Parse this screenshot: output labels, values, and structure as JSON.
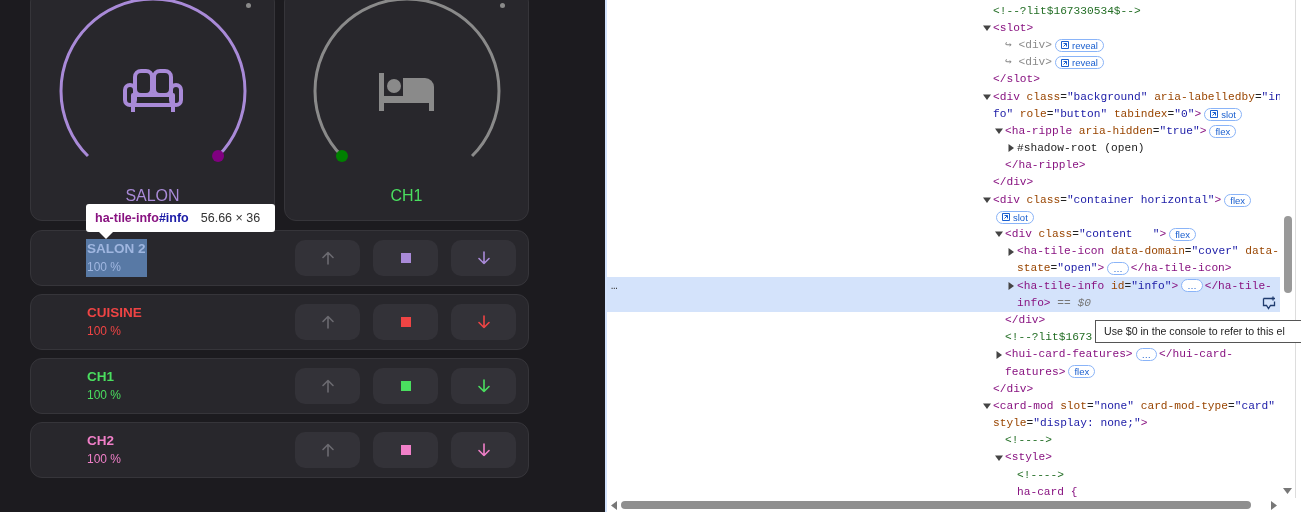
{
  "dials": [
    {
      "name": "SALON",
      "color": "#a98ad8",
      "active": true
    },
    {
      "name": "CH1",
      "color": "#4ade5f",
      "active": false
    }
  ],
  "inspect_tooltip": {
    "selector_tag": "ha-tile-info",
    "selector_id": "#info",
    "size": "56.66 × 36"
  },
  "rows": [
    {
      "name": "SALON 2",
      "reading": "100 %",
      "color": "#a98ad8",
      "highlighted": true,
      "up_disabled": true
    },
    {
      "name": "CUISINE",
      "reading": "100 %",
      "color": "#ef4444",
      "highlighted": false,
      "up_disabled": true
    },
    {
      "name": "CH1",
      "reading": "100 %",
      "color": "#4ade5f",
      "highlighted": false,
      "up_disabled": true
    },
    {
      "name": "CH2",
      "reading": "100 %",
      "color": "#f07fc8",
      "highlighted": false,
      "up_disabled": true
    }
  ],
  "devtools": {
    "nodes": [
      {
        "children": [
          {
            "open": [
              [
                {
                  "kind": "comment",
                  "text": "<!--?lit$167330534$-->"
                }
              ]
            ]
          },
          {
            "expanded": true,
            "open": [
              [
                {
                  "kind": "tag",
                  "text": "<slot>"
                }
              ]
            ],
            "children": [
              {
                "open": [
                  [
                    {
                      "kind": "dim",
                      "text": "↪ <div>"
                    },
                    {
                      "kind": "badge",
                      "text": "reveal",
                      "icon": true
                    }
                  ]
                ]
              },
              {
                "open": [
                  [
                    {
                      "kind": "dim",
                      "text": "↪ <div>"
                    },
                    {
                      "kind": "badge",
                      "text": "reveal",
                      "icon": true
                    }
                  ]
                ]
              }
            ],
            "close": [
              {
                "kind": "tag",
                "text": "</slot>"
              }
            ]
          }
        ]
      },
      {
        "expanded": true,
        "open": [
          [
            {
              "kind": "tag",
              "text": "<div "
            },
            {
              "kind": "attr",
              "text": "class"
            },
            {
              "kind": "plain",
              "text": "="
            },
            {
              "kind": "val",
              "text": "\"background\" "
            },
            {
              "kind": "attr",
              "text": "aria-labelledby"
            },
            {
              "kind": "plain",
              "text": "="
            },
            {
              "kind": "val",
              "text": "\"in"
            }
          ],
          [
            {
              "kind": "val",
              "text": "fo\" "
            },
            {
              "kind": "attr",
              "text": "role"
            },
            {
              "kind": "plain",
              "text": "="
            },
            {
              "kind": "val",
              "text": "\"button\" "
            },
            {
              "kind": "attr",
              "text": "tabindex"
            },
            {
              "kind": "plain",
              "text": "="
            },
            {
              "kind": "val",
              "text": "\"0\""
            },
            {
              "kind": "tag",
              "text": ">"
            },
            {
              "kind": "badge",
              "text": "slot",
              "icon": true
            }
          ]
        ],
        "children": [
          {
            "expanded": true,
            "open": [
              [
                {
                  "kind": "tag",
                  "text": "<ha-ripple "
                },
                {
                  "kind": "attr",
                  "text": "aria-hidden"
                },
                {
                  "kind": "plain",
                  "text": "="
                },
                {
                  "kind": "val",
                  "text": "\"true\""
                },
                {
                  "kind": "tag",
                  "text": ">"
                },
                {
                  "kind": "badge",
                  "text": "flex",
                  "icon": false
                }
              ]
            ],
            "children": [
              {
                "expanded": false,
                "open": [
                  [
                    {
                      "kind": "plain",
                      "text": "#shadow-root (open)"
                    }
                  ]
                ]
              }
            ],
            "close": [
              {
                "kind": "tag",
                "text": "</ha-ripple>"
              }
            ]
          }
        ],
        "close": [
          {
            "kind": "tag",
            "text": "</div>"
          }
        ]
      },
      {
        "expanded": true,
        "open": [
          [
            {
              "kind": "tag",
              "text": "<div "
            },
            {
              "kind": "attr",
              "text": "class"
            },
            {
              "kind": "plain",
              "text": "="
            },
            {
              "kind": "val",
              "text": "\"container horizontal\""
            },
            {
              "kind": "tag",
              "text": ">"
            },
            {
              "kind": "badge",
              "text": "flex",
              "icon": false
            }
          ],
          [
            {
              "kind": "badge",
              "text": "slot",
              "icon": true
            }
          ]
        ],
        "children": [
          {
            "expanded": true,
            "open": [
              [
                {
                  "kind": "tag",
                  "text": "<div "
                },
                {
                  "kind": "attr",
                  "text": "class"
                },
                {
                  "kind": "plain",
                  "text": "="
                },
                {
                  "kind": "val",
                  "text": "\"content   \""
                },
                {
                  "kind": "tag",
                  "text": ">"
                },
                {
                  "kind": "badge",
                  "text": "flex",
                  "icon": false
                }
              ]
            ],
            "children": [
              {
                "expanded": false,
                "open": [
                  [
                    {
                      "kind": "tag",
                      "text": "<ha-tile-icon "
                    },
                    {
                      "kind": "attr",
                      "text": "data-domain"
                    },
                    {
                      "kind": "plain",
                      "text": "="
                    },
                    {
                      "kind": "val",
                      "text": "\"cover\" "
                    },
                    {
                      "kind": "attr",
                      "text": "data-"
                    }
                  ],
                  [
                    {
                      "kind": "attr",
                      "text": "state"
                    },
                    {
                      "kind": "plain",
                      "text": "="
                    },
                    {
                      "kind": "val",
                      "text": "\"open\""
                    },
                    {
                      "kind": "tag",
                      "text": ">"
                    },
                    {
                      "kind": "badge",
                      "text": "…",
                      "icon": false
                    },
                    {
                      "kind": "tag",
                      "text": "</ha-tile-icon>"
                    }
                  ]
                ]
              },
              {
                "expanded": false,
                "selected": true,
                "gutter": "…",
                "open": [
                  [
                    {
                      "kind": "tag",
                      "text": "<ha-tile-info "
                    },
                    {
                      "kind": "attr",
                      "text": "id"
                    },
                    {
                      "kind": "plain",
                      "text": "="
                    },
                    {
                      "kind": "val",
                      "text": "\"info\""
                    },
                    {
                      "kind": "tag",
                      "text": ">"
                    },
                    {
                      "kind": "badge",
                      "text": "…",
                      "icon": false
                    },
                    {
                      "kind": "tag",
                      "text": "</ha-tile-"
                    }
                  ],
                  [
                    {
                      "kind": "tag",
                      "text": "info>"
                    },
                    {
                      "kind": "hint",
                      "text": " == $0"
                    }
                  ]
                ]
              }
            ],
            "close": [
              {
                "kind": "tag",
                "text": "</div>"
              }
            ]
          },
          {
            "open": [
              [
                {
                  "kind": "comment",
                  "text": "<!--?lit$1673"
                }
              ]
            ]
          },
          {
            "expanded": false,
            "open": [
              [
                {
                  "kind": "tag",
                  "text": "<hui-card-features>"
                },
                {
                  "kind": "badge",
                  "text": "…",
                  "icon": false
                },
                {
                  "kind": "tag",
                  "text": "</hui-card-"
                }
              ],
              [
                {
                  "kind": "tag",
                  "text": "features>"
                },
                {
                  "kind": "badge",
                  "text": "flex",
                  "icon": false
                }
              ]
            ]
          }
        ],
        "close": [
          {
            "kind": "tag",
            "text": "</div>"
          }
        ]
      },
      {
        "expanded": true,
        "open": [
          [
            {
              "kind": "tag",
              "text": "<card-mod "
            },
            {
              "kind": "attr",
              "text": "slot"
            },
            {
              "kind": "plain",
              "text": "="
            },
            {
              "kind": "val",
              "text": "\"none\" "
            },
            {
              "kind": "attr",
              "text": "card-mod-type"
            },
            {
              "kind": "plain",
              "text": "="
            },
            {
              "kind": "val",
              "text": "\"card\""
            }
          ],
          [
            {
              "kind": "attr",
              "text": "style"
            },
            {
              "kind": "plain",
              "text": "="
            },
            {
              "kind": "val",
              "text": "\"display: none;\""
            },
            {
              "kind": "tag",
              "text": ">"
            }
          ]
        ],
        "children": [
          {
            "open": [
              [
                {
                  "kind": "comment",
                  "text": "<!---->"
                }
              ]
            ]
          },
          {
            "expanded": true,
            "open": [
              [
                {
                  "kind": "tag",
                  "text": "<style>"
                }
              ]
            ],
            "children": [
              {
                "open": [
                  [
                    {
                      "kind": "comment",
                      "text": "<!---->"
                    }
                  ]
                ]
              },
              {
                "open": [
                  [
                    {
                      "kind": "tag",
                      "text": "ha-card {"
                    }
                  ]
                ]
              }
            ]
          }
        ]
      }
    ],
    "console_tip": "Use $0 in the console to refer to this el"
  }
}
